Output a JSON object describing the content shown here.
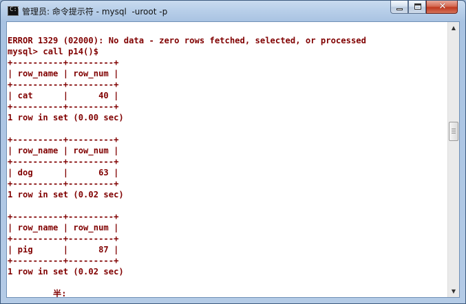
{
  "window": {
    "title": "管理员: 命令提示符 - mysql  -uroot -p",
    "icon": "cmd-icon"
  },
  "controls": {
    "minimize_icon": "minimize-icon",
    "maximize_icon": "maximize-icon",
    "close_icon": "close-icon",
    "close_glyph": "✕"
  },
  "console": {
    "lines": [
      "",
      "ERROR 1329 (02000): No data - zero rows fetched, selected, or processed",
      "mysql> call p14()$",
      "+----------+---------+",
      "| row_name | row_num |",
      "+----------+---------+",
      "| cat      |      40 |",
      "+----------+---------+",
      "1 row in set (0.00 sec)",
      "",
      "+----------+---------+",
      "| row_name | row_num |",
      "+----------+---------+",
      "| dog      |      63 |",
      "+----------+---------+",
      "1 row in set (0.02 sec)",
      "",
      "+----------+---------+",
      "| row_name | row_num |",
      "+----------+---------+",
      "| pig      |      87 |",
      "+----------+---------+",
      "1 row in set (0.02 sec)",
      "",
      "         半:"
    ]
  },
  "colors": {
    "console_text": "#800000",
    "console_background": "#ffffff",
    "titlebar": "#b8cfe9"
  },
  "scrollbar": {
    "up_arrow": "▲",
    "down_arrow": "▼"
  }
}
